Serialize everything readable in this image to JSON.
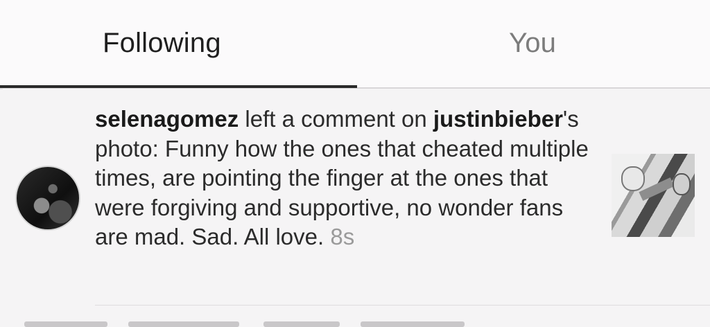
{
  "tabs": {
    "following": "Following",
    "you": "You"
  },
  "notification": {
    "username": "selenagomez",
    "action": " left a comment on ",
    "target_user": "justinbieber",
    "target_suffix": "'s photo: ",
    "comment_text": "Funny how the ones that cheated multiple times, are pointing the finger at the ones that were forgiving and supportive, no wonder fans are mad. Sad. All love.",
    "timestamp": "8s"
  },
  "icons": {
    "avatar": "profile-avatar",
    "thumbnail": "photo-thumbnail"
  }
}
